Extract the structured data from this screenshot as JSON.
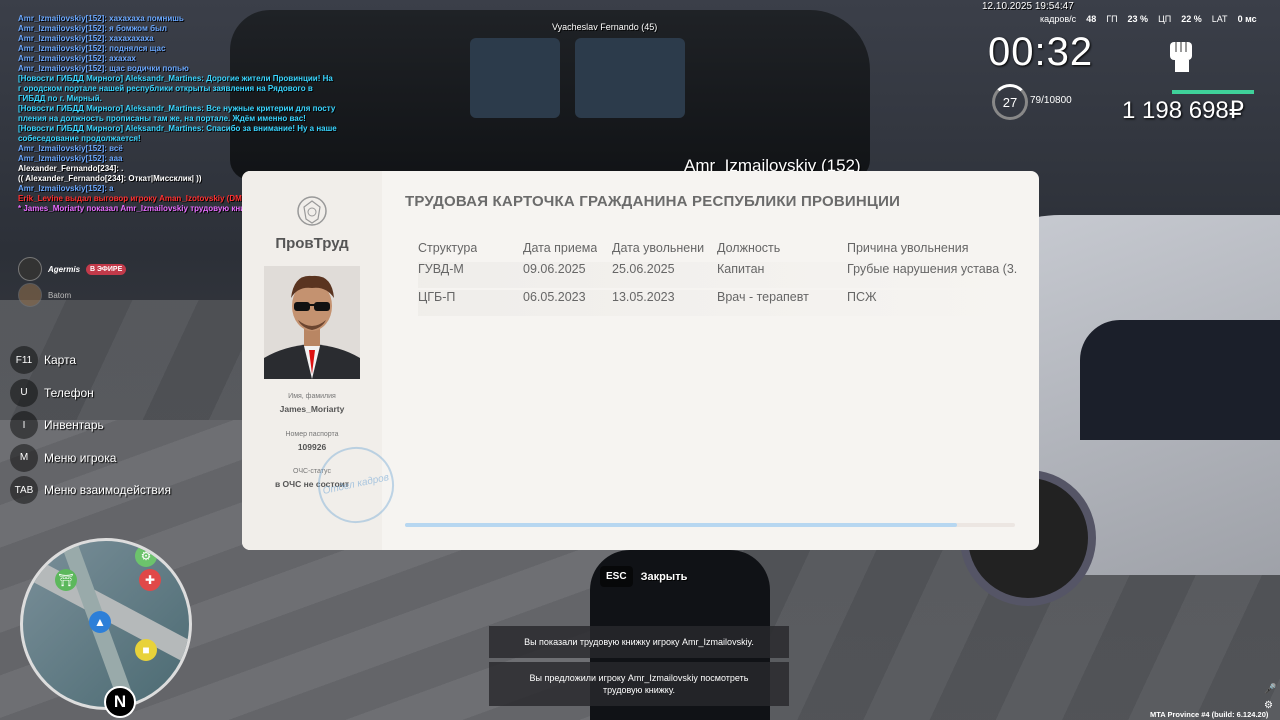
{
  "chat": [
    {
      "text": "Amr_Izmailovskiy[152]: хахахаха помнишь",
      "color": "blue"
    },
    {
      "text": "Amr_Izmailovskiy[152]: я бомжом был",
      "color": "blue"
    },
    {
      "text": "Amr_Izmailovskiy[152]: хахахахаха",
      "color": "blue"
    },
    {
      "text": "Amr_Izmailovskiy[152]: поднялся щас",
      "color": "blue"
    },
    {
      "text": "Amr_Izmailovskiy[152]: ахахах",
      "color": "blue"
    },
    {
      "text": "Amr_Izmailovskiy[152]: щас водички попью",
      "color": "blue"
    },
    {
      "text": "[Новости ГИБДД Мирного] Aleksandr_Martines: Дорогие жители Провинции! На г ородском портале нашей республики открыты заявления на Рядового в ГИБДД по г. Мирный.",
      "color": "cyan"
    },
    {
      "text": "[Новости ГИБДД Мирного] Aleksandr_Martines: Все нужные критерии для посту пления на должность прописаны там же, на портале. Ждём именно вас!",
      "color": "cyan"
    },
    {
      "text": "[Новости ГИБДД Мирного] Aleksandr_Martines: Спасибо за внимание! Ну а наше собеседование продолжается!",
      "color": "cyan"
    },
    {
      "text": "Amr_Izmailovskiy[152]: всё",
      "color": "blue"
    },
    {
      "text": "Amr_Izmailovskiy[152]: ааа",
      "color": "blue"
    },
    {
      "text": "Alexander_Fernando[234]: .",
      "color": "white"
    },
    {
      "text": "(( Alexander_Fernando[234]: Откат|Миссклик| ))",
      "color": "white"
    },
    {
      "text": "Amr_Izmailovskiy[152]: а",
      "color": "blue"
    },
    {
      "text": "Erik_Levine выдал выговор игроку Aman_Izotovskiy (DM car by ATH)",
      "color": "red"
    },
    {
      "text": "* James_Moriarty показал Amr_Izmailovskiy трудовую книжку",
      "color": "pink"
    }
  ],
  "voice": {
    "user1": "Agermis",
    "onair": "В ЭФИРЕ",
    "user2": "Batom"
  },
  "hotkeys": [
    {
      "key": "F11",
      "label": "Карта"
    },
    {
      "key": "U",
      "label": "Телефон"
    },
    {
      "key": "I",
      "label": "Инвентарь"
    },
    {
      "key": "M",
      "label": "Меню игрока"
    },
    {
      "key": "TAB",
      "label": "Меню взаимодействия"
    }
  ],
  "hud": {
    "datetime": "12.10.2025 19:54:47",
    "fps_label": "кадров/с",
    "fps": "48",
    "gpu_label": "ГП",
    "gpu": "23 %",
    "cpu_label": "ЦП",
    "cpu": "22 %",
    "lat_label": "LAT",
    "lat": "0 мс",
    "time": "00:32",
    "level": "27",
    "exp": "79/10800",
    "money": "1 198 698₽"
  },
  "nametags": {
    "driver": "Vyacheslav Fernando (45)",
    "player": "Amr_Izmailovskiy (152)"
  },
  "card": {
    "org": "ПровТруд",
    "title": "ТРУДОВАЯ КАРТОЧКА ГРАЖДАНИНА РЕСПУБЛИКИ ПРОВИНЦИИ",
    "name_label": "Имя, фамилия",
    "name": "James_Moriarty",
    "passport_label": "Номер паспорта",
    "passport": "109926",
    "ochs_label": "ОЧС-статус",
    "ochs": "в ОЧС не состоит",
    "stamp": "Отдел кадров",
    "columns": [
      "Структура",
      "Дата приема",
      "Дата увольнени",
      "Должность",
      "Причина увольнения"
    ],
    "rows": [
      [
        "ГУВД-М",
        "09.06.2025",
        "25.06.2025",
        "Капитан",
        "Грубые нарушения устава (3."
      ],
      [
        "ЦГБ-П",
        "06.05.2023",
        "13.05.2023",
        "Врач - терапевт",
        "ПСЖ"
      ]
    ],
    "scroll_fraction": 0.905
  },
  "close": {
    "key": "ESC",
    "label": "Закрыть"
  },
  "notifications": [
    "Вы показали трудовую книжку игроку Amr_Izmailovskiy.",
    "Вы предложили игроку Amr_Izmailovskiy посмотреть трудовую книжку."
  ],
  "build": "MTA Province #4 (build: 6.124.20)",
  "minimap_north": "N"
}
